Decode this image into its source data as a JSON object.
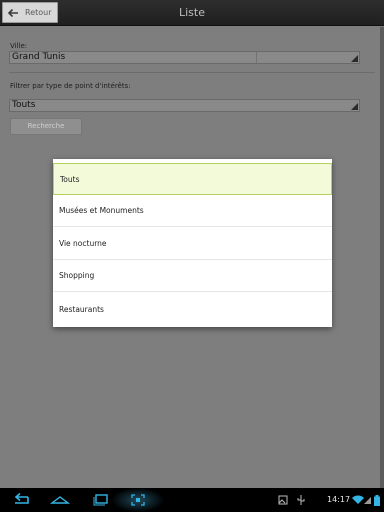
{
  "action_bar": {
    "back_label": "Retour",
    "title": "Liste"
  },
  "form": {
    "ville_label": "Ville:",
    "ville_value": "Grand Tunis",
    "filter_label": "Filtrer par type de point d'intérêts:",
    "filter_value": "Touts",
    "search_button": "Recherche"
  },
  "dialog": {
    "items": [
      {
        "label": "Touts",
        "selected": true
      },
      {
        "label": "Musées et Monuments",
        "selected": false
      },
      {
        "label": "Vie nocturne",
        "selected": false
      },
      {
        "label": "Shopping",
        "selected": false
      },
      {
        "label": "Restaurants",
        "selected": false
      }
    ]
  },
  "status_bar": {
    "time": "14:17"
  },
  "colors": {
    "accent_selection": "#b4d35e",
    "selection_fill": "#f2fad9",
    "nav_icon": "#33b5e5"
  },
  "icons": [
    "back-arrow-icon",
    "spinner-arrow-icon",
    "nav-back-icon",
    "nav-home-icon",
    "nav-recent-apps-icon",
    "screenshot-icon",
    "gallery-icon",
    "usb-icon",
    "wifi-icon",
    "signal-icon",
    "battery-icon"
  ]
}
